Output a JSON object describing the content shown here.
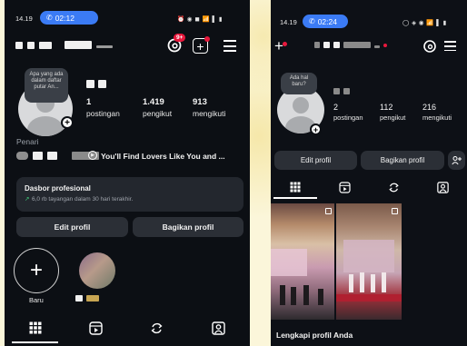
{
  "left_screen": {
    "status": {
      "time": "14.19",
      "call_timer": "02:12",
      "system_icons": "⏰ ◉ ◼ 📶 ▌ ▮"
    },
    "notification_badge": "9+",
    "bio_bubble": "Apa yang ada dalam daftar putar An...",
    "stats": [
      {
        "value": "1",
        "label": "postingan"
      },
      {
        "value": "1.419",
        "label": "pengikut"
      },
      {
        "value": "913",
        "label": "mengikuti"
      }
    ],
    "category": "Penari",
    "music_text": "You'll Find Lovers Like You and ...",
    "dashboard": {
      "title": "Dasbor profesional",
      "subtitle": "6,0 rb tayangan dalam 30 hari terakhir."
    },
    "buttons": {
      "edit": "Edit profil",
      "share": "Bagikan profil"
    },
    "highlight_new_label": "Baru",
    "colors": {
      "accent_blue": "#3b7bf5",
      "badge_red": "#e8183c",
      "trend_green": "#3fcf7a"
    }
  },
  "right_screen": {
    "status": {
      "time": "14.19",
      "call_timer": "02:24",
      "system_icons": "◯ ◈ ◉ 📶 ▌ ▮"
    },
    "bio_bubble": "Ada hal baru?",
    "stats": [
      {
        "value": "2",
        "label": "postingan"
      },
      {
        "value": "112",
        "label": "pengikut"
      },
      {
        "value": "216",
        "label": "mengikuti"
      }
    ],
    "buttons": {
      "edit": "Edit profil",
      "share": "Bagikan profil"
    },
    "footer_text": "Lengkapi profil Anda"
  }
}
